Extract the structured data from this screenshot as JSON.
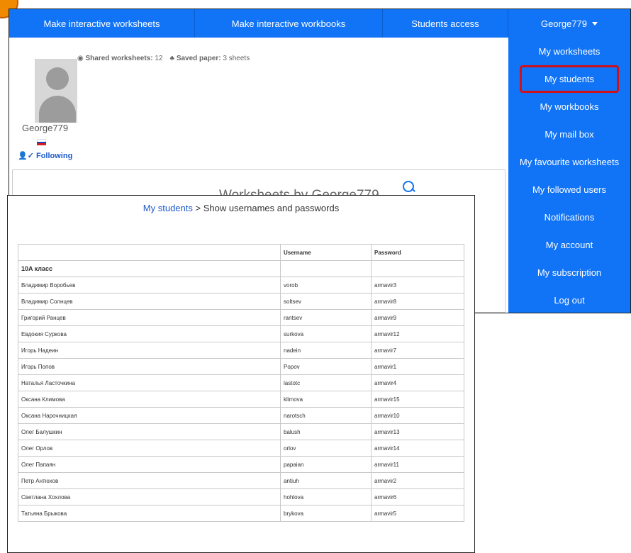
{
  "topnav": {
    "items": [
      "Make interactive worksheets",
      "Make interactive workbooks",
      "Students access",
      "George779"
    ]
  },
  "user_menu": {
    "items": [
      "My worksheets",
      "My students",
      "My workbooks",
      "My mail box",
      "My favourite worksheets",
      "My followed users",
      "Notifications",
      "My account",
      "My subscription",
      "Log out"
    ],
    "highlighted": "My students",
    "highlight_color": "#d0101b"
  },
  "profile": {
    "username": "George779",
    "following": "Following",
    "shared_label": "Shared worksheets:",
    "shared_value": "12",
    "saved_label": "Saved paper:",
    "saved_value": "3 sheets",
    "flag_colors": [
      "#ffffff",
      "#1f3fb5",
      "#d21f1f"
    ]
  },
  "worksheets_title": "Worksheets by George779",
  "students_page": {
    "breadcrumb_link": "My students",
    "breadcrumb_rest": " > Show usernames and passwords",
    "headers": [
      "",
      "Username",
      "Password"
    ],
    "group": "10A класс",
    "rows": [
      [
        "Владимир Воробьев",
        "vorob",
        "armavir3"
      ],
      [
        "Владимир Солнцев",
        "soltsev",
        "armavir8"
      ],
      [
        "Григорий Ранцев",
        "rantsev",
        "armavir9"
      ],
      [
        "Евдокия Суркова",
        "surkova",
        "armavir12"
      ],
      [
        "Игорь Надеин",
        "nadein",
        "armavir7"
      ],
      [
        "Игорь Попов",
        "Popov",
        "armavir1"
      ],
      [
        "Наталья Ласточкина",
        "lastotc",
        "armavir4"
      ],
      [
        "Оксана Климова",
        "klimova",
        "armavir15"
      ],
      [
        "Оксана Нарочницкая",
        "narotsch",
        "armavir10"
      ],
      [
        "Олег Балушкин",
        "balush",
        "armavir13"
      ],
      [
        "Олег Орлов",
        "orlov",
        "armavir14"
      ],
      [
        "Олег Папаян",
        "papaian",
        "armavir11"
      ],
      [
        "Петр Антюхов",
        "antiuh",
        "armavir2"
      ],
      [
        "Светлана Хохлова",
        "hohlova",
        "armavir6"
      ],
      [
        "Татьяна Брыкова",
        "brykova",
        "armavir5"
      ]
    ]
  },
  "colors": {
    "nav_blue": "#1173f5",
    "link_blue": "#1e59c9",
    "badge_orange": "#f08a00"
  },
  "icons": {
    "dropdown": "chevron-down-icon",
    "follow": "user-check-icon",
    "search": "search-icon"
  }
}
